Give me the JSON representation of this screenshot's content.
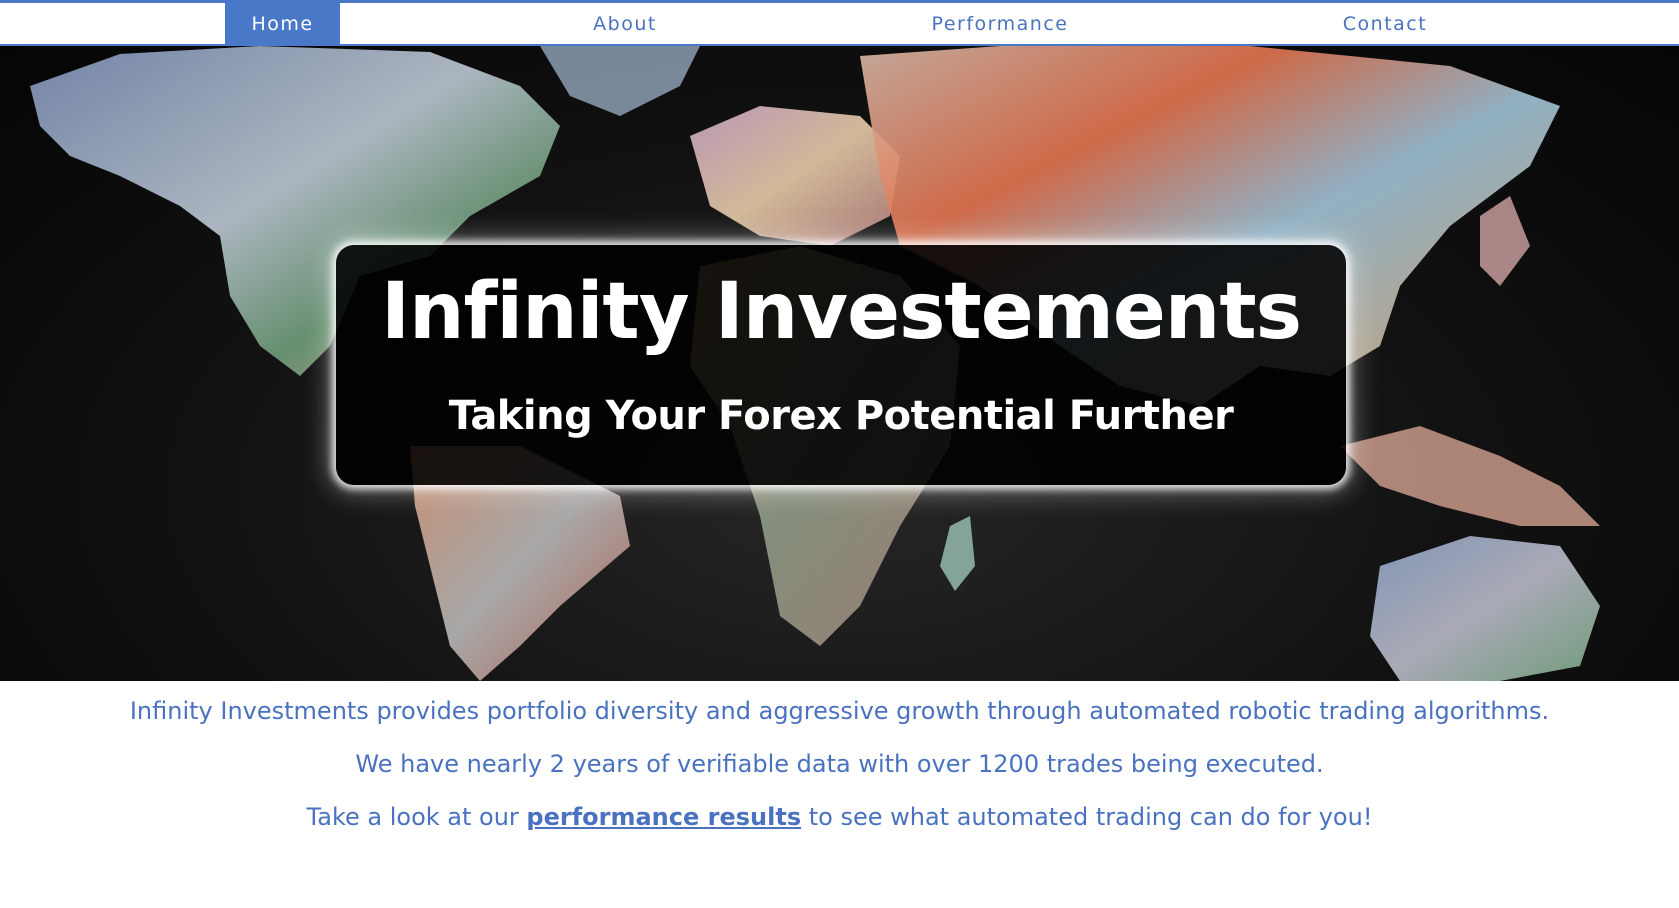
{
  "nav": {
    "items": [
      {
        "label": "Home",
        "active": true
      },
      {
        "label": "About",
        "active": false
      },
      {
        "label": "Performance",
        "active": false
      },
      {
        "label": "Contact",
        "active": false
      }
    ]
  },
  "hero": {
    "title": "Infinity Investements",
    "subtitle": "Taking Your Forex Potential Further"
  },
  "content": {
    "line1": "Infinity Investments provides portfolio diversity and aggressive growth through automated robotic trading algorithms.",
    "line2": "We have nearly 2 years of verifiable data with over 1200 trades being executed.",
    "line3_prefix": "Take a look at our ",
    "line3_link": "performance results",
    "line3_suffix": " to see what automated trading can do for you!"
  },
  "colors": {
    "accent": "#4a78c8",
    "text_link": "#4a72c0",
    "hero_background": "#111111"
  }
}
